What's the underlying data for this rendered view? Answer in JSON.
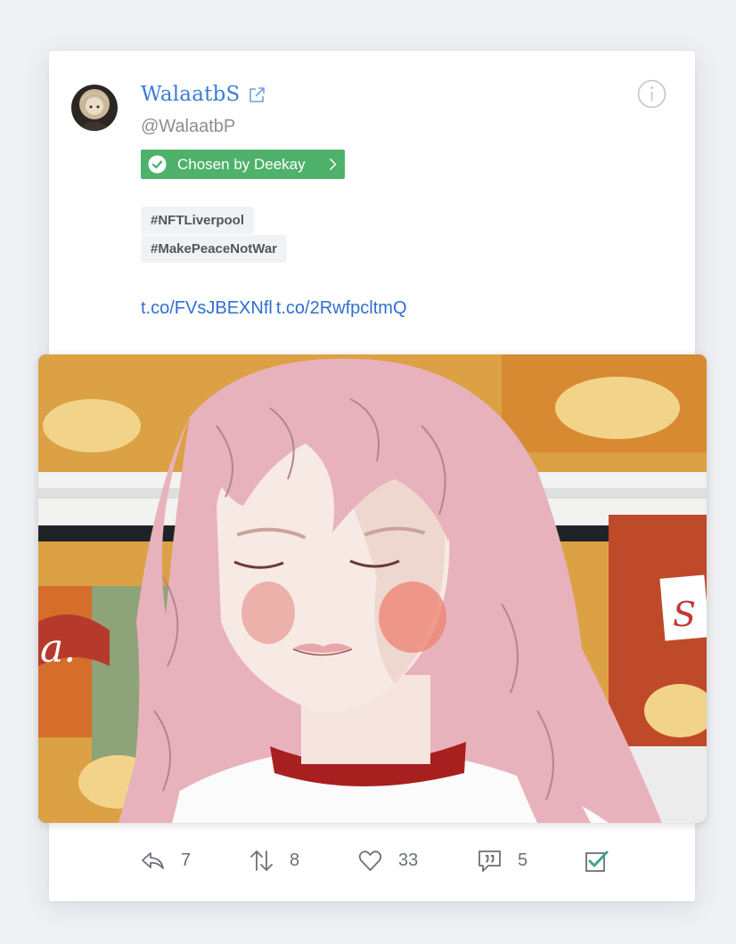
{
  "user": {
    "display_name": "WalaatbS",
    "handle": "@WalaatbP",
    "avatar_icon": "avatar"
  },
  "badge": {
    "label": "Chosen by Deekay",
    "color": "#4fb26b"
  },
  "tags": [
    "#NFTLiverpool",
    "#MakePeaceNotWar"
  ],
  "links": [
    "t.co/FVsJBEXNfl",
    "t.co/2RwfpcltmQ"
  ],
  "media": {
    "description_icon": "illustration-image"
  },
  "actions": {
    "reply": {
      "icon": "reply-icon",
      "count": "7"
    },
    "retweet": {
      "icon": "retweet-icon",
      "count": "8"
    },
    "like": {
      "icon": "heart-icon",
      "count": "33"
    },
    "quote": {
      "icon": "quote-icon",
      "count": "5"
    },
    "select": {
      "icon": "checkbox-icon"
    }
  },
  "colors": {
    "accent": "#3a7ad6",
    "link": "#2f6fd1",
    "badge": "#4fb26b"
  }
}
